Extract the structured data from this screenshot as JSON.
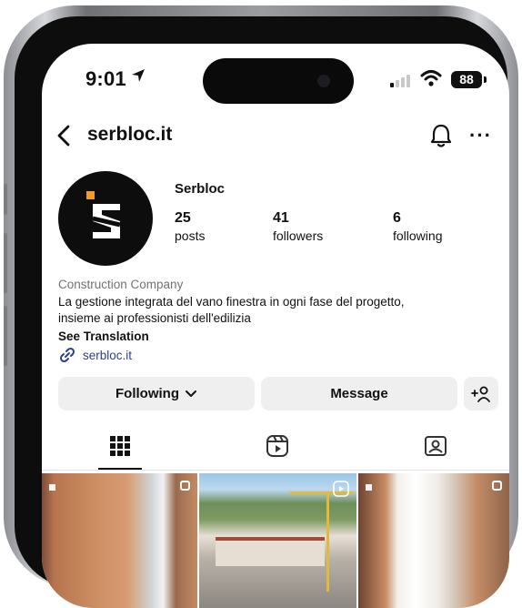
{
  "status_bar": {
    "time": "9:01",
    "battery": "88"
  },
  "header": {
    "handle": "serbloc.it"
  },
  "profile": {
    "display_name": "Serbloc",
    "stats": [
      {
        "value": "25",
        "label": "posts"
      },
      {
        "value": "41",
        "label": "followers"
      },
      {
        "value": "6",
        "label": "following"
      }
    ],
    "category": "Construction Company",
    "bio_line1": "La gestione integrata del vano finestra in ogni fase del progetto,",
    "bio_line2": "insieme ai professionisti dell'edilizia",
    "see_translation": "See Translation",
    "link": "serbloc.it"
  },
  "actions": {
    "following": "Following",
    "message": "Message"
  },
  "tabs": [
    {
      "icon": "grid-icon",
      "active": true
    },
    {
      "icon": "reels-icon",
      "active": false
    },
    {
      "icon": "tagged-icon",
      "active": false
    }
  ],
  "colors": {
    "brand_accent": "#f39a2a",
    "link": "#2f3f8a",
    "button_bg": "#efefef"
  }
}
